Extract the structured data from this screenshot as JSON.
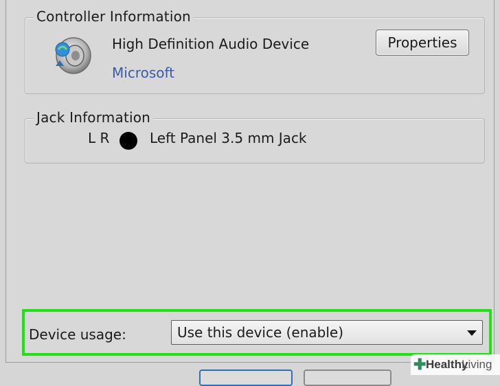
{
  "controller": {
    "title": "Controller Information",
    "device_name": "High Definition Audio Device",
    "manufacturer": "Microsoft",
    "properties_label": "Properties",
    "icon": "speaker-icon"
  },
  "jack": {
    "title": "Jack Information",
    "channels": "L R",
    "description": "Left Panel 3.5 mm Jack",
    "dot_color": "#000000"
  },
  "usage": {
    "label": "Device usage:",
    "selected": "Use this device (enable)",
    "highlight_color": "#22e016"
  },
  "watermark": {
    "part1": "Healthy",
    "part2": "Living"
  }
}
